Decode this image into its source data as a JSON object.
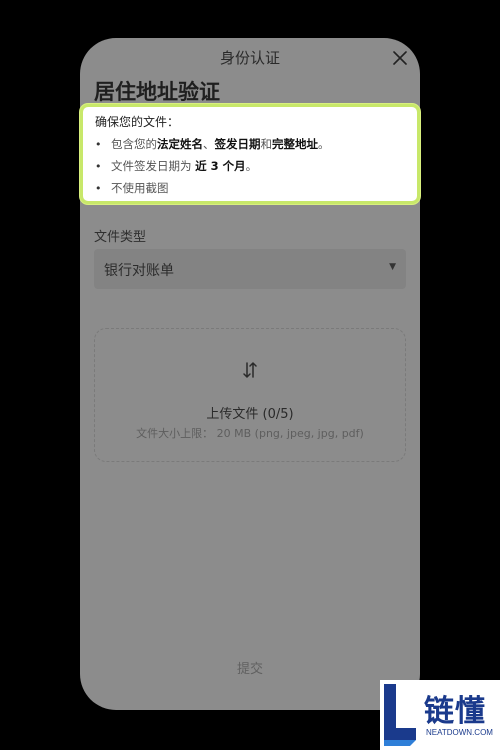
{
  "header": {
    "title": "身份认证",
    "close_icon": "close-icon"
  },
  "page": {
    "title": "居住地址验证"
  },
  "requirements": {
    "heading": "确保您的文件：",
    "item1": {
      "prefix": "包含您的",
      "part1": "法定姓名",
      "sep1": "、",
      "part2": "签发日期",
      "sep2": "和",
      "part3": "完整地址",
      "suffix": "。"
    },
    "item2": {
      "prefix": "文件签发日期为",
      "emph": "近 3 个月",
      "suffix": "。"
    },
    "item3": {
      "text": "不使用截图"
    },
    "highlight_color": "#c8e86a"
  },
  "document": {
    "label": "文件类型",
    "selected": "银行对账单"
  },
  "upload": {
    "title": "上传文件 (0/5)",
    "hint": "文件大小上限： 20 MB (png, jpeg, jpg, pdf)",
    "icon": "swap-arrows-icon"
  },
  "actions": {
    "submit": "提交"
  },
  "watermark": {
    "brand": "链懂",
    "site": "NEATDOWN.COM"
  }
}
